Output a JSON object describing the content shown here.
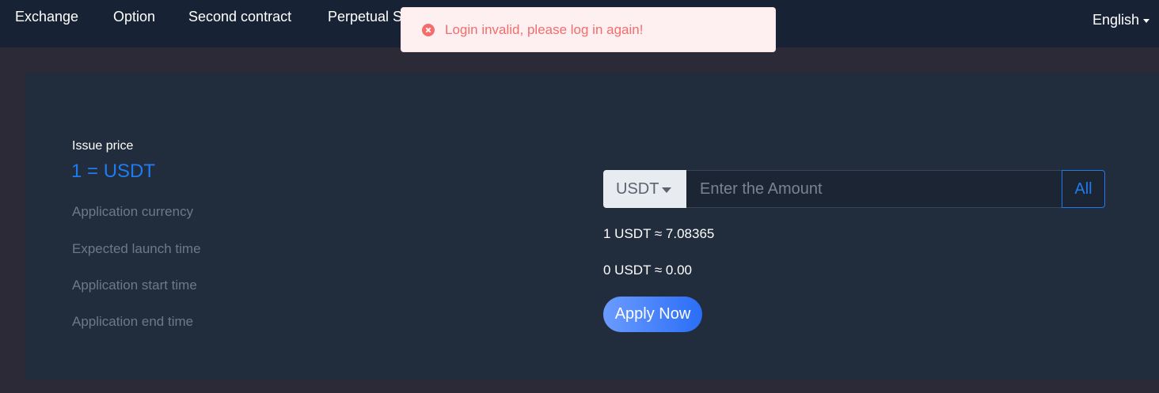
{
  "nav": {
    "items": [
      {
        "label": "Exchange"
      },
      {
        "label": "Option"
      },
      {
        "label": "Second contract"
      },
      {
        "label": "Perpetual S"
      }
    ],
    "language": "English"
  },
  "toast": {
    "type": "error",
    "message": "Login invalid, please log in again!",
    "icon": "error-circle-icon"
  },
  "issue": {
    "price_label": "Issue price",
    "price_value": "1 = USDT",
    "fields": [
      {
        "label": "Application currency"
      },
      {
        "label": "Expected launch time"
      },
      {
        "label": "Application start time"
      },
      {
        "label": "Application end time"
      }
    ]
  },
  "apply": {
    "currency": "USDT",
    "amount_placeholder": "Enter the Amount",
    "all_label": "All",
    "rate_line": "1 USDT ≈ 7.08365",
    "total_line": "0 USDT ≈ 0.00",
    "button_label": "Apply Now"
  },
  "colors": {
    "accent": "#1f7cf0",
    "error": "#f56c6c",
    "nav_bg": "#172334",
    "panel_bg": "#212c3d"
  }
}
